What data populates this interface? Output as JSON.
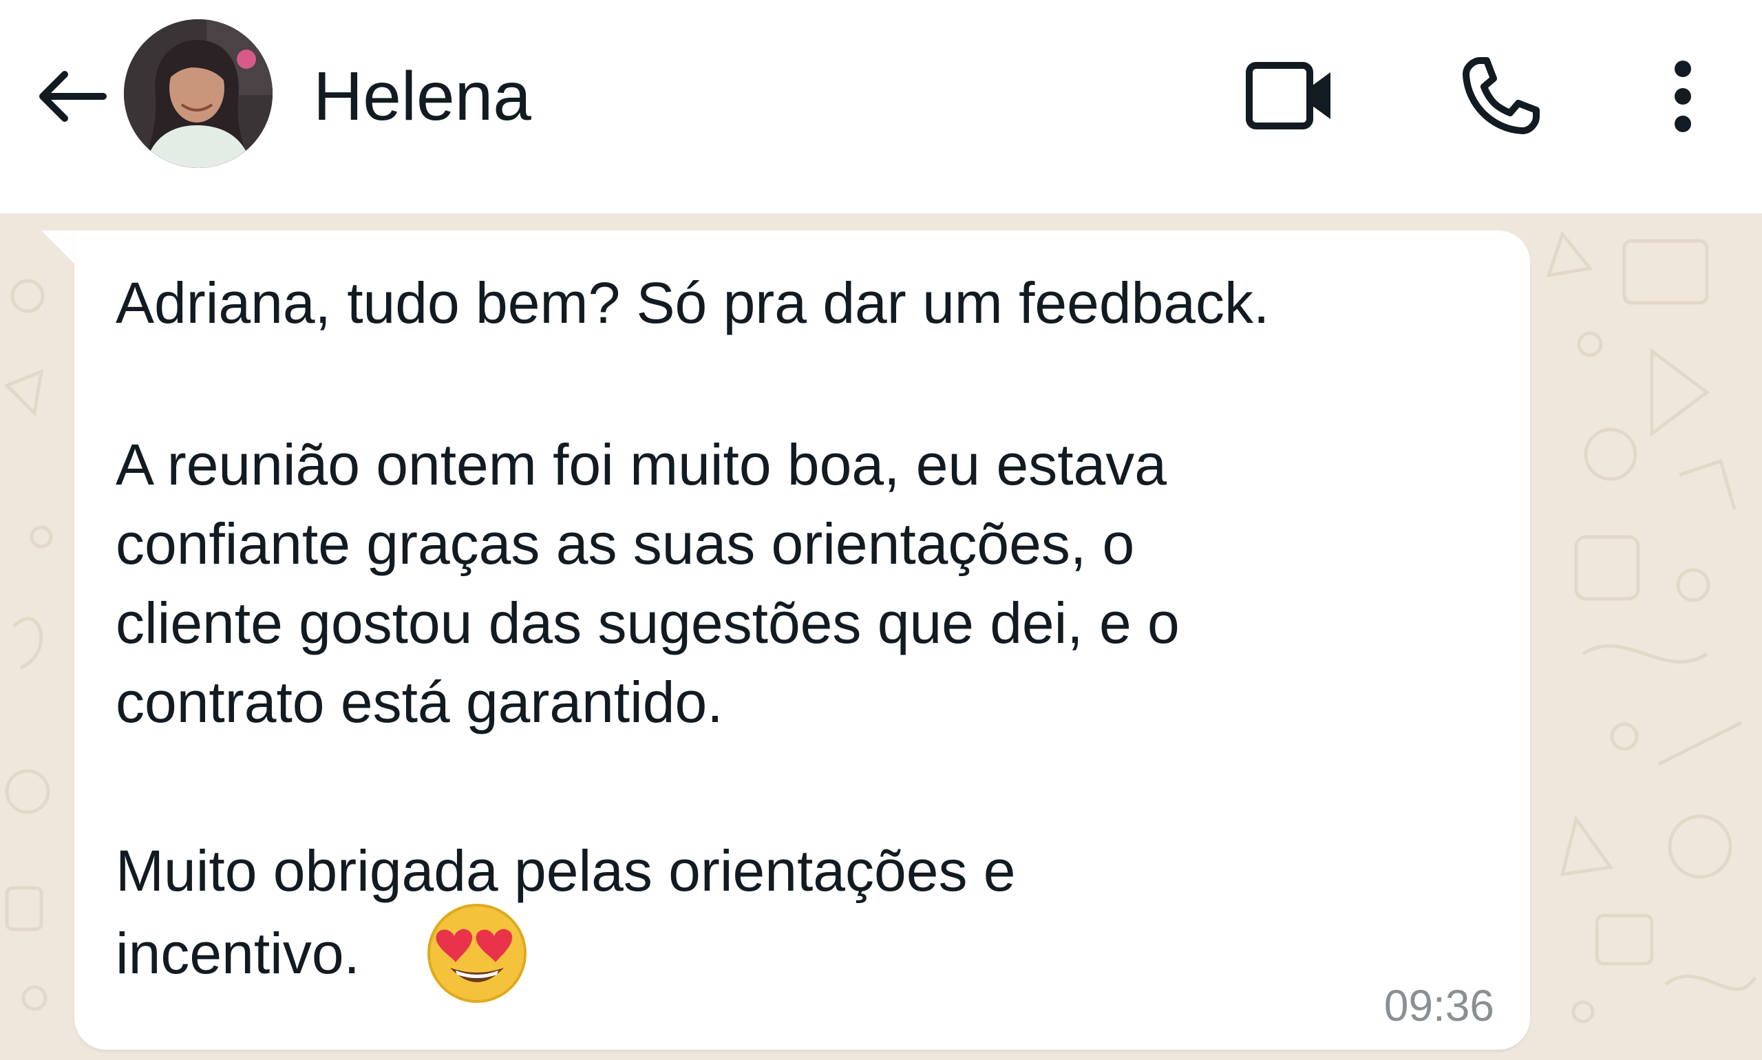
{
  "header": {
    "back_icon": "arrow-left-icon",
    "contact_name": "Helena",
    "video_icon": "video-camera-icon",
    "call_icon": "phone-icon",
    "more_icon": "more-vertical-icon"
  },
  "message": {
    "lines": [
      "Adriana, tudo bem? Só pra dar um feedback.",
      "A reunião ontem foi muito boa, eu estava",
      "confiante graças as suas orientações, o",
      "cliente gostou das sugestões que dei, e o",
      "contrato está garantido.",
      "Muito obrigada pelas orientações e",
      "incentivo."
    ],
    "emoji": "heart-eyes-emoji",
    "time": "09:36"
  },
  "colors": {
    "header_bg": "#ffffff",
    "wallpaper_bg": "#efe7dc",
    "wallpaper_doodle": "#e3d8c8",
    "bubble_bg": "#ffffff",
    "text": "#111b21",
    "time_text": "#8a8f93",
    "icon": "#111b21"
  }
}
